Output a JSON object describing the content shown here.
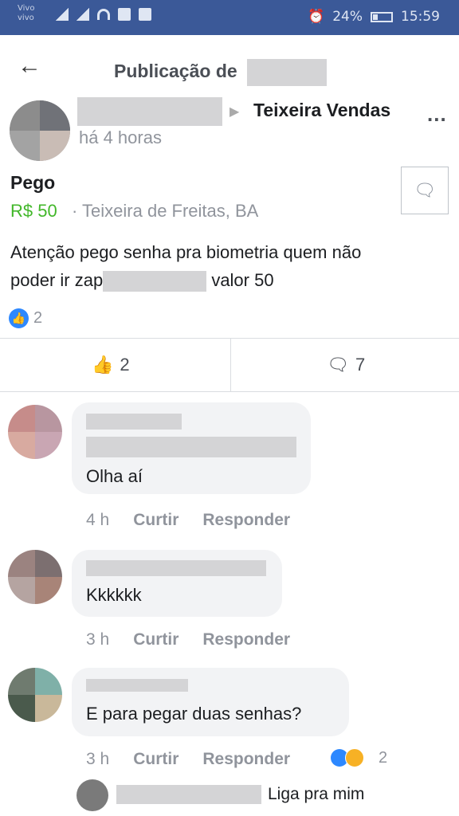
{
  "status_bar": {
    "carrier": "Vivo\nvivo",
    "battery": "24%",
    "time": "15:59"
  },
  "header": {
    "title": "Publicação de"
  },
  "post": {
    "group": "Teixeira Vendas",
    "time": "há 4 horas",
    "title": "Pego",
    "price": "R$ 50",
    "location": "· Teixeira de Freitas, BA",
    "body_line1": "Atenção pego senha pra biometria quem não",
    "body_line2_start": "poder ir zap",
    "body_line2_end": "valor 50",
    "reaction_count": "2"
  },
  "actions": {
    "like_count": "2",
    "comment_count": "7"
  },
  "comments": [
    {
      "text": "Olha aí",
      "time": "4 h",
      "like_label": "Curtir",
      "reply_label": "Responder"
    },
    {
      "text": "Kkkkkk",
      "time": "3 h",
      "like_label": "Curtir",
      "reply_label": "Responder"
    },
    {
      "text": "E para pegar duas senhas?",
      "time": "3 h",
      "like_label": "Curtir",
      "reply_label": "Responder",
      "reaction_count": "2"
    }
  ],
  "reply_preview": {
    "text": "Liga pra mim"
  },
  "colors": {
    "status_bar": "#3b5998",
    "price": "#42b72a",
    "like_blue": "#2d88ff"
  }
}
